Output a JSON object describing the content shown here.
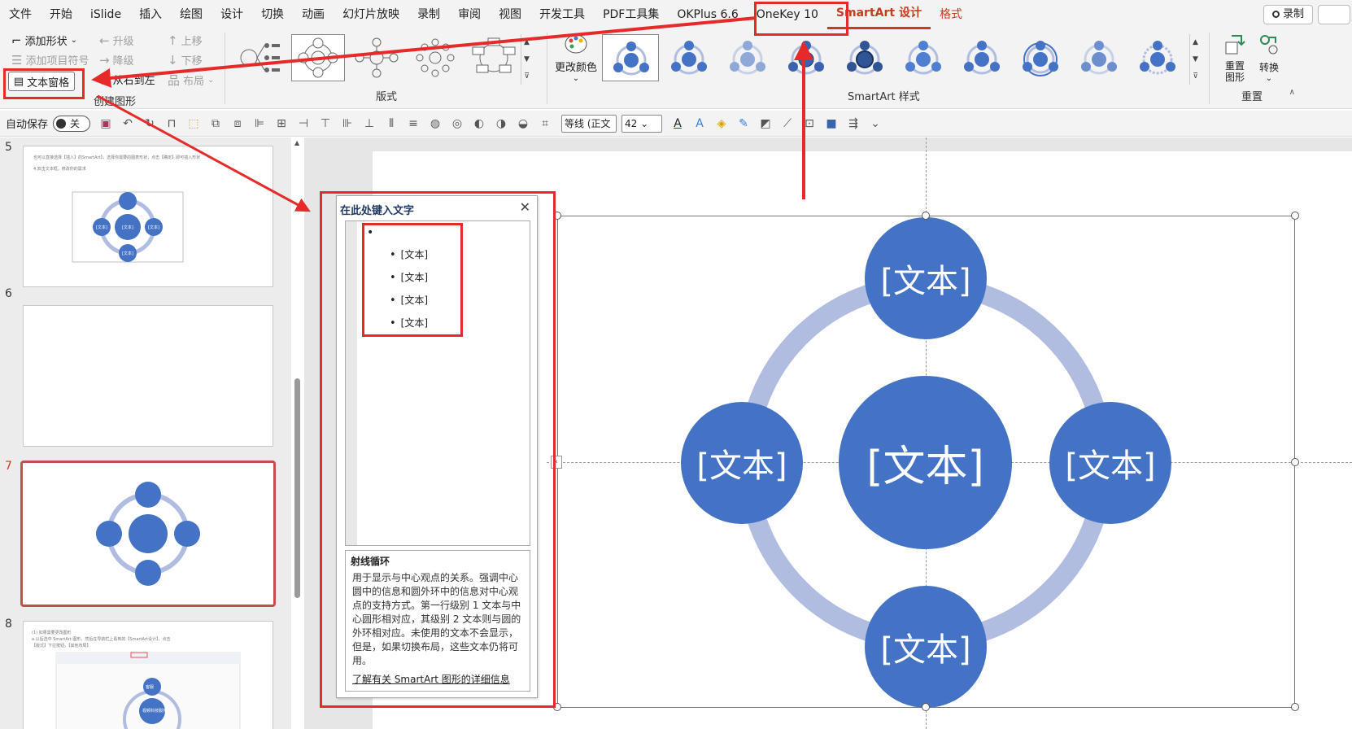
{
  "menu": {
    "items": [
      "文件",
      "开始",
      "iSlide",
      "插入",
      "绘图",
      "设计",
      "切换",
      "动画",
      "幻灯片放映",
      "录制",
      "审阅",
      "视图",
      "开发工具",
      "PDF工具集",
      "OKPlus 6.6",
      "OneKey 10"
    ],
    "active": "SmartArt 设计",
    "format": "格式",
    "record": "录制"
  },
  "ribbon": {
    "add_shape": "添加形状",
    "add_bullet": "添加项目符号",
    "text_pane": "文本窗格",
    "promote": "升级",
    "demote": "降级",
    "right_to_left": "从右到左",
    "move_up": "上移",
    "move_down": "下移",
    "layout_btn": "布局",
    "create_graphic_label": "创建图形",
    "layouts_label": "版式",
    "change_colors": "更改颜色",
    "styles_label": "SmartArt 样式",
    "reset_graphic": "重置\n图形",
    "convert": "转换",
    "reset_label": "重置"
  },
  "qat": {
    "autosave": "自动保存",
    "toggle": "关",
    "font": "等线 (正文",
    "size": "42"
  },
  "slides": [
    {
      "number": "5",
      "texts": [
        "也可以直接选择【插入】的SmartArt】，选择你需要的图表形状，点击【确定】即可插入形状",
        "4.双击文本框，修改你的需求"
      ],
      "nodes": [
        "[文本]",
        "[文本]",
        "[文本]",
        "[文本]"
      ]
    },
    {
      "number": "6"
    },
    {
      "number": "7"
    },
    {
      "number": "8",
      "texts": [
        "(1) 如果需要更改图形",
        "a.以后选中 SmartArt 图形，然后在导航栏上看到的【SmartArt设计】，点击",
        "【版式】下拉按钮，【其他布局】"
      ],
      "nodes": [
        "客服",
        "视频科技服务"
      ]
    }
  ],
  "text_pane": {
    "title": "在此处键入文字",
    "items": [
      "[文本]",
      "[文本]",
      "[文本]",
      "[文本]"
    ],
    "desc_title": "射线循环",
    "desc_body": "用于显示与中心观点的关系。强调中心圆中的信息和圆外环中的信息对中心观点的支持方式。第一行级别 1 文本与中心圆形相对应，其级别 2 文本则与圆的外环相对应。未使用的文本不会显示，但是，如果切换布局，这些文本仍将可用。",
    "link": "了解有关 SmartArt 图形的详细信息"
  },
  "smartart": {
    "center": "[文本]",
    "top": "[文本]",
    "left": "[文本]",
    "right": "[文本]",
    "bottom": "[文本]",
    "node_color": "#4472c4",
    "ring_color": "#b0bde0"
  },
  "colors": {
    "accent": "#c43e1c",
    "annotation": "#e62a2a"
  }
}
